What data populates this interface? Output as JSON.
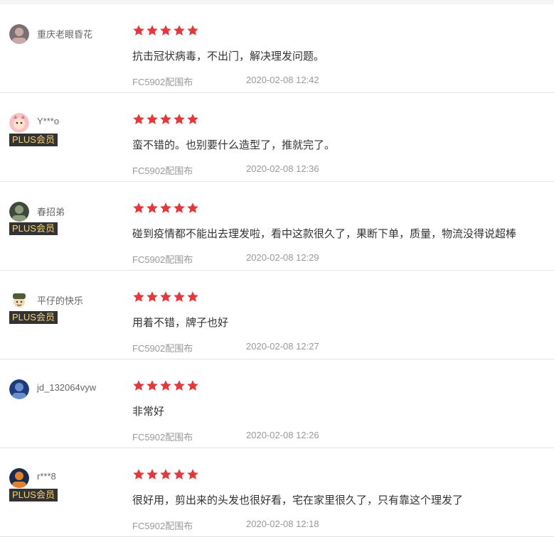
{
  "reviews": [
    {
      "user": "重庆老眼昏花",
      "plus": false,
      "plus_label": "",
      "rating": 5,
      "content": "抗击冠状病毒，不出门，解决理发问题。",
      "product": "FC5902配围布",
      "date": "2020-02-08 12:42",
      "avatar_icon": "avatar-photo-icon",
      "avatar_colors": [
        "#7c6f73",
        "#c9a9a6"
      ]
    },
    {
      "user": "Y***o",
      "plus": true,
      "plus_label": "PLUS会员",
      "rating": 5,
      "content": "蛮不错的。也别要什么造型了，推就完了。",
      "product": "FC5902配围布",
      "date": "2020-02-08 12:36",
      "avatar_icon": "avatar-cartoon-icon",
      "avatar_colors": [
        "#f6c2c5",
        "#e86f7b"
      ]
    },
    {
      "user": "春招弟",
      "plus": true,
      "plus_label": "PLUS会员",
      "rating": 5,
      "content": "碰到疫情都不能出去理发啦，看中这款很久了，果断下单，质量，物流没得说超棒",
      "product": "FC5902配围布",
      "date": "2020-02-08 12:29",
      "avatar_icon": "avatar-photo-icon",
      "avatar_colors": [
        "#3d4a3b",
        "#8e9a7f"
      ]
    },
    {
      "user": "平仔的快乐",
      "plus": true,
      "plus_label": "PLUS会员",
      "rating": 5,
      "content": "用着不错，牌子也好",
      "product": "FC5902配围布",
      "date": "2020-02-08 12:27",
      "avatar_icon": "avatar-soldier-icon",
      "avatar_colors": [
        "#4f5c3a",
        "#f3d9b5"
      ]
    },
    {
      "user": "jd_132064vyw",
      "plus": false,
      "plus_label": "",
      "rating": 5,
      "content": "非常好",
      "product": "FC5902配围布",
      "date": "2020-02-08 12:26",
      "avatar_icon": "avatar-photo-icon",
      "avatar_colors": [
        "#1f3c7a",
        "#6a8fd0"
      ]
    },
    {
      "user": "r***8",
      "plus": true,
      "plus_label": "PLUS会员",
      "rating": 5,
      "content": "很好用，剪出来的头发也很好看，宅在家里很久了，只有靠这个理发了",
      "product": "FC5902配围布",
      "date": "2020-02-08 12:18",
      "avatar_icon": "avatar-photo-icon",
      "avatar_colors": [
        "#1b2a4a",
        "#e0802f"
      ]
    }
  ],
  "colors": {
    "star": "#e4393c",
    "plus_bg": "#333333",
    "plus_text": "#f3d27b"
  }
}
